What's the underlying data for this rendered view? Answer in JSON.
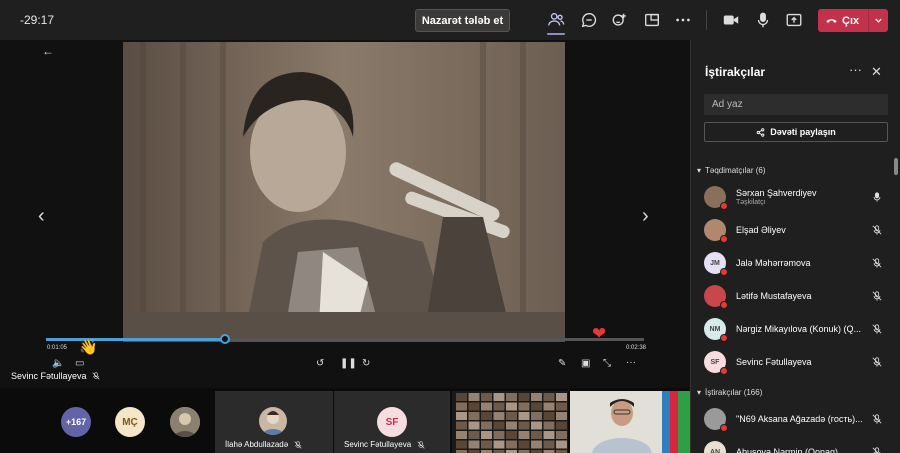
{
  "topbar": {
    "timer": "-29:17",
    "request_control_label": "Nazarət tələb et",
    "leave_label": "Çıx"
  },
  "stage": {
    "progress_fraction": 0.3,
    "time_elapsed": "0:01:05",
    "time_total": "0:02:38",
    "presenter_name": "Sevinc Fətullayeva"
  },
  "gallery": {
    "more_count": "+167",
    "tile_initials": "MÇ",
    "tile2_name": "İlahə Abdullazadə",
    "tile3_initials": "SF",
    "tile3_name": "Sevinc Fətullayeva"
  },
  "panel": {
    "title": "İştirakçılar",
    "search_placeholder": "Ad yaz",
    "share_label": "Dəvəti paylaşın",
    "presenters_header": "Təqdimatçılar (6)",
    "presenters": [
      {
        "name": "Sərxan Şahverdiyev",
        "role": "Təşkilatçı",
        "initials": "",
        "avatar_color": "#8a6f5a",
        "mic": "on"
      },
      {
        "name": "Elşad Əliyev",
        "role": "",
        "initials": "",
        "avatar_color": "#b08870",
        "mic": "off"
      },
      {
        "name": "Jalə Məhərrəmova",
        "role": "",
        "initials": "JM",
        "avatar_color": "#e6e0f5",
        "mic": "off"
      },
      {
        "name": "Lətifə Mustafayeva",
        "role": "",
        "initials": "",
        "avatar_color": "#c9464b",
        "mic": "off"
      },
      {
        "name": "Nərgiz Mikayılova (Konuk) (Q...",
        "role": "",
        "initials": "NM",
        "avatar_color": "#d9eaea",
        "mic": "off"
      },
      {
        "name": "Sevinc Fətullayeva",
        "role": "",
        "initials": "SF",
        "avatar_color": "#f7dde0",
        "mic": "off"
      }
    ],
    "attendees_header": "İştirakçılar (166)",
    "attendees": [
      {
        "name": "\"N69 Aksana Ağazadə (гость)...",
        "initials": "",
        "avatar_color": "#9a9a9a",
        "mic": "off"
      },
      {
        "name": "Abusova Nərmin (Qonaq)",
        "initials": "AN",
        "avatar_color": "#e8e0d0",
        "mic": "off"
      }
    ]
  }
}
